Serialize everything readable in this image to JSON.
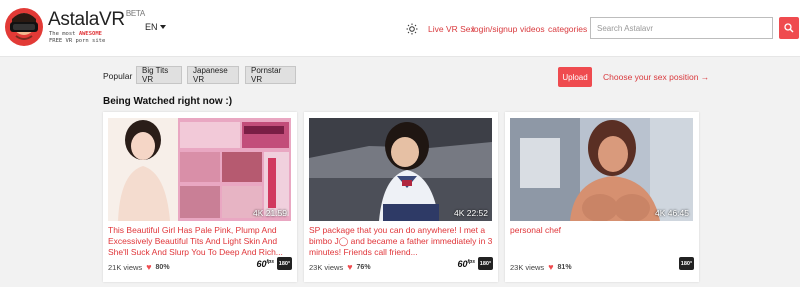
{
  "brand": {
    "name": "AstalaVR",
    "beta": "BETA",
    "tagline_1_pre": "The most ",
    "tagline_1_bold": "AWESOME",
    "tagline_2": "FREE VR porn site"
  },
  "lang": "EN",
  "nav": {
    "live": "Live VR Sex",
    "login": "login/signup",
    "videos": "videos",
    "categories": "categories"
  },
  "search": {
    "placeholder": "Search Astalavr"
  },
  "filters": {
    "label": "Popular",
    "chips": [
      "Big Tits VR",
      "Japanese VR",
      "Pornstar VR"
    ]
  },
  "upload": "Upload",
  "position_link": "Choose your sex position →",
  "section_title": "Being Watched right now :)",
  "colors": {
    "accent": "#ef4b4f",
    "link": "#d93a3e"
  },
  "cards": [
    {
      "badge": "4K 21:59",
      "title": "This Beautiful Girl Has Pale Pink, Plump And Excessively Beautiful Tits And Light Skin And She'll Suck And Slurp You To Deep And Rich...",
      "views": "21K views",
      "likes": "80%",
      "fps": "60",
      "fps_unit": "fps",
      "deg": "180°"
    },
    {
      "badge": "4K 22:52",
      "title": "SP package that you can do anywhere! I met a bimbo J◯ and became a father immediately in 3 minutes! Friends call friend...",
      "views": "23K views",
      "likes": "76%",
      "fps": "60",
      "fps_unit": "fps",
      "deg": "180°"
    },
    {
      "badge": "4K 46:45",
      "title": "personal chef",
      "views": "23K views",
      "likes": "81%",
      "deg": "180°"
    }
  ]
}
